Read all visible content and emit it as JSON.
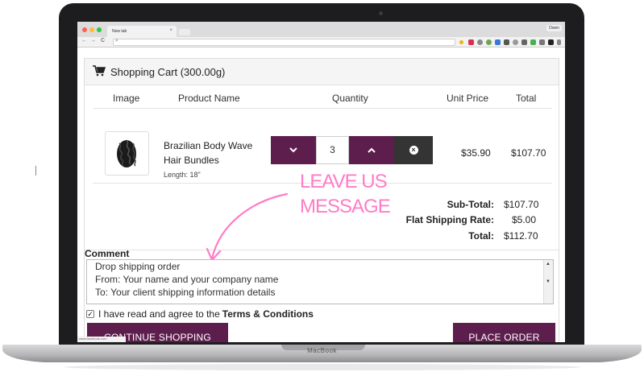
{
  "laptop": {
    "brand": "MacBook"
  },
  "browser": {
    "tab_title": "New tab",
    "tab_close": "×",
    "profile": "Owen",
    "nav": {
      "back": "←",
      "forward": "→",
      "reload": "C"
    },
    "url": "",
    "status_url": "www.facebook.com"
  },
  "cart": {
    "title": "Shopping Cart  (300.00g)",
    "columns": {
      "image": "Image",
      "product": "Product Name",
      "quantity": "Quantity",
      "unit_price": "Unit Price",
      "total": "Total"
    },
    "item": {
      "name": "Brazilian Body Wave Hair Bundles",
      "option": "Length: 18\"",
      "quantity": "3",
      "unit_price": "$35.90",
      "total": "$107.70",
      "decrease_icon": "chevron-down-icon",
      "increase_icon": "chevron-up-icon",
      "remove_icon": "remove-circle-icon"
    },
    "totals": [
      {
        "label": "Sub-Total:",
        "value": "$107.70"
      },
      {
        "label": "Flat Shipping Rate:",
        "value": "$5.00"
      },
      {
        "label": "Total:",
        "value": "$112.70"
      }
    ]
  },
  "annotation": {
    "line1": "LEAVE US",
    "line2": "MESSAGE",
    "color": "#ff7cc7"
  },
  "comment": {
    "label": "Comment",
    "lines": [
      "Drop shipping order",
      "From: Your name and your company name",
      "To: Your client shipping information details"
    ]
  },
  "agreement": {
    "text": "I have read and agree to the",
    "link": "Terms & Conditions",
    "checked": true
  },
  "buttons": {
    "continue": "CONTINUE SHOPPING",
    "place_order": "PLACE ORDER"
  },
  "colors": {
    "accent": "#5e1e4d",
    "dark": "#343434",
    "annotation": "#ff7cc7"
  }
}
